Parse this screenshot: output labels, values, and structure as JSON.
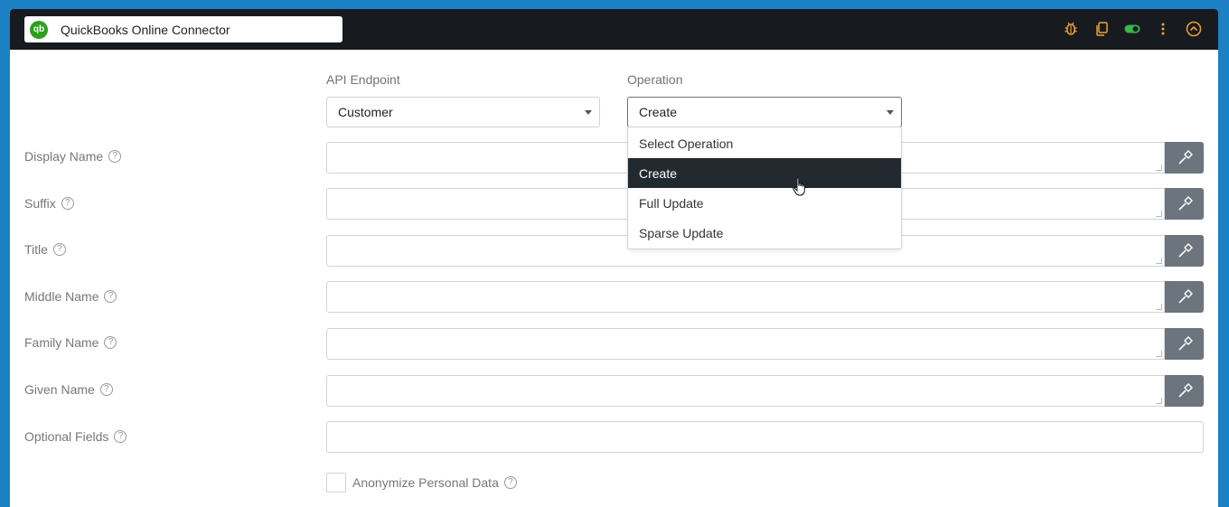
{
  "header": {
    "title": "QuickBooks Online Connector",
    "logo_text": "qb",
    "icons": [
      "bug-icon",
      "copy-icon",
      "toggle-icon",
      "more-vertical-icon",
      "collapse-up-icon"
    ],
    "accent_color": "#f0a030",
    "toggle_color": "#3ab54a"
  },
  "api_endpoint": {
    "label": "API Endpoint",
    "value": "Customer"
  },
  "operation": {
    "label": "Operation",
    "value": "Create",
    "options": [
      "Select Operation",
      "Create",
      "Full Update",
      "Sparse Update"
    ],
    "selected_index": 1
  },
  "fields": [
    {
      "label": "Display Name",
      "value": ""
    },
    {
      "label": "Suffix",
      "value": ""
    },
    {
      "label": "Title",
      "value": ""
    },
    {
      "label": "Middle Name",
      "value": ""
    },
    {
      "label": "Family Name",
      "value": ""
    },
    {
      "label": "Given Name",
      "value": ""
    }
  ],
  "optional_fields": {
    "label": "Optional Fields",
    "value": ""
  },
  "anonymize": {
    "label": "Anonymize Personal Data",
    "checked": false
  },
  "help_glyph": "?"
}
